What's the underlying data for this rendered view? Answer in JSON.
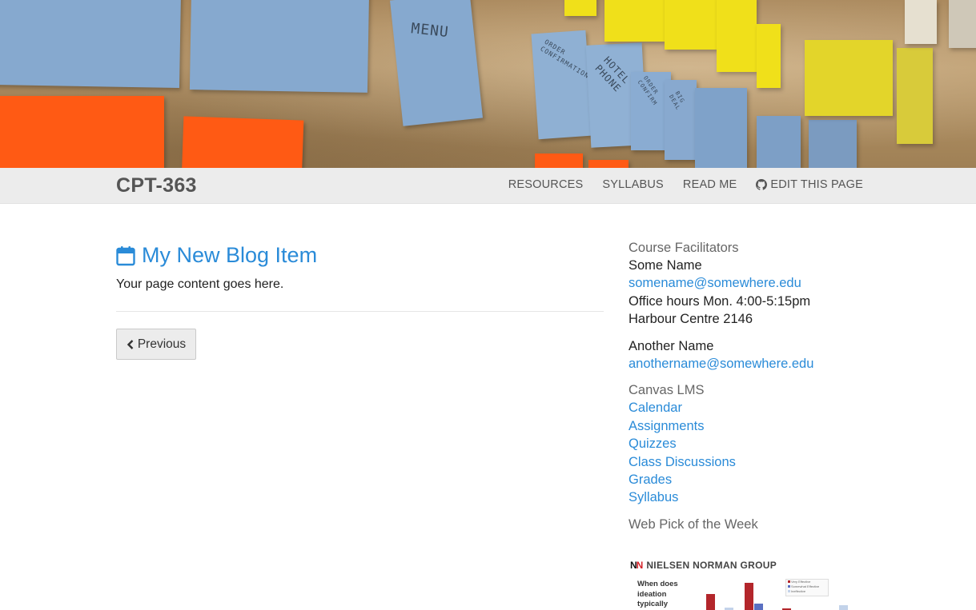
{
  "hero": {
    "notes_text": [
      "MENU",
      "ORDER CONFIRMATION",
      "HOTEL PHONE",
      "ORDER CONFIRM",
      "BIG DEAL"
    ]
  },
  "navbar": {
    "brand": "CPT-363",
    "links": [
      {
        "label": "RESOURCES"
      },
      {
        "label": "SYLLABUS"
      },
      {
        "label": "READ ME"
      },
      {
        "label": "EDIT THIS PAGE",
        "icon": "github-icon"
      }
    ]
  },
  "post": {
    "title": "My New Blog Item",
    "title_icon": "calendar-icon",
    "body": "Your page content goes here.",
    "previous_label": "Previous"
  },
  "sidebar": {
    "facilitators_heading": "Course Facilitators",
    "facilitator1": {
      "name": "Some Name",
      "email": "somename@somewhere.edu",
      "hours": "Office hours Mon. 4:00-5:15pm",
      "room": "Harbour Centre 2146"
    },
    "facilitator2": {
      "name": "Another Name",
      "email": "anothername@somewhere.edu"
    },
    "canvas_heading": "Canvas LMS",
    "canvas_links": [
      "Calendar",
      "Assignments",
      "Quizzes",
      "Class Discussions",
      "Grades",
      "Syllabus"
    ],
    "pick_heading": "Web Pick of the Week",
    "pick": {
      "logo_mark_1": "N",
      "logo_mark_2": "N",
      "logo_text": "NIELSEN NORMAN GROUP",
      "question": [
        "When does",
        "ideation",
        "typically"
      ],
      "legend": [
        "Very Effective",
        "Somewhat Effective",
        "Ineffective"
      ]
    }
  },
  "colors": {
    "link": "#2a8bd8",
    "navbar_bg": "#ececec",
    "brand_text": "#555555"
  }
}
